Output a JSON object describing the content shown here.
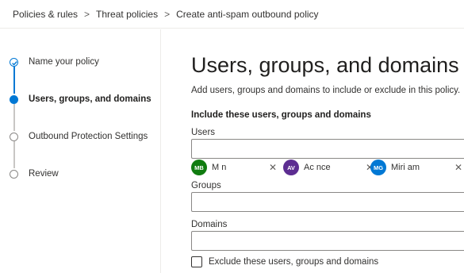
{
  "breadcrumb": {
    "items": [
      "Policies & rules",
      "Threat policies",
      "Create anti-spam outbound policy"
    ],
    "separator": ">"
  },
  "wizard": {
    "steps": [
      {
        "label": "Name your policy",
        "state": "done"
      },
      {
        "label": "Users, groups, and domains",
        "state": "current"
      },
      {
        "label": "Outbound Protection Settings",
        "state": "pending"
      },
      {
        "label": "Review",
        "state": "pending"
      }
    ]
  },
  "main": {
    "title": "Users, groups, and domains",
    "description": "Add users, groups and domains to include or exclude in this policy.",
    "section_heading": "Include these users, groups and domains",
    "users_label": "Users",
    "groups_label": "Groups",
    "domains_label": "Domains",
    "selected_users": [
      {
        "initials": "MB",
        "name": "M          n",
        "color": "#107c10"
      },
      {
        "initials": "AV",
        "name": "Ac          nce",
        "color": "#5c2d91"
      },
      {
        "initials": "MG",
        "name": "Miri          am",
        "color": "#0078d4"
      }
    ],
    "remove_glyph": "✕",
    "exclude_label": "Exclude these users, groups and domains"
  },
  "colors": {
    "accent": "#0078d4",
    "border": "#8a8886",
    "divider": "#edebe9"
  }
}
